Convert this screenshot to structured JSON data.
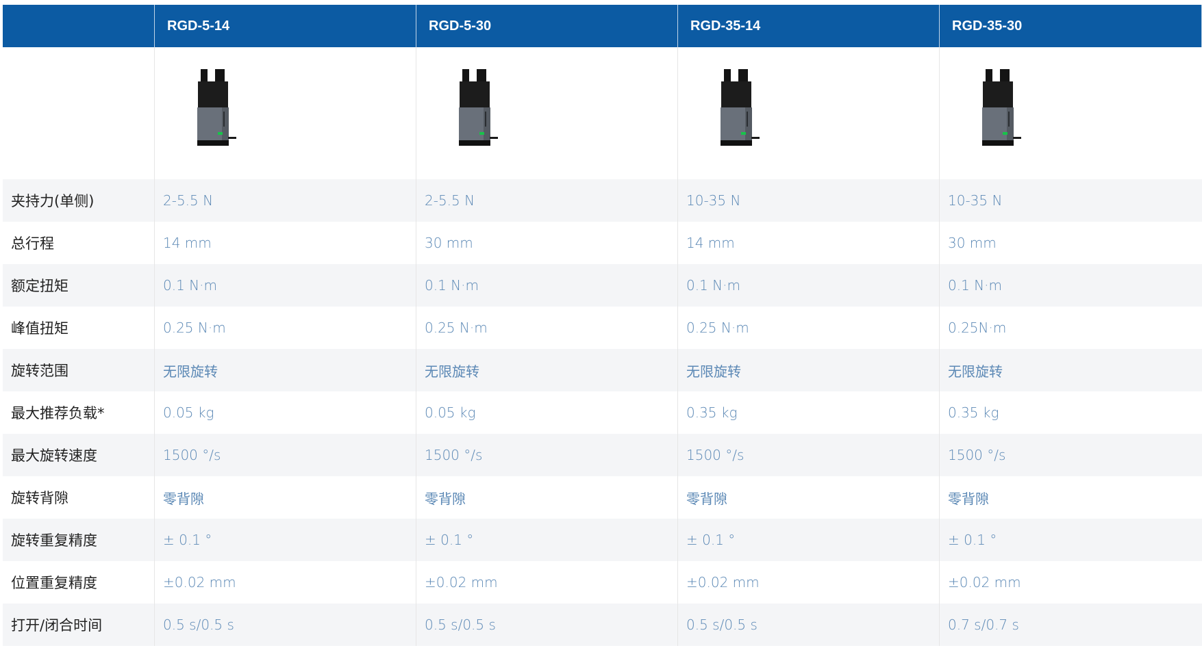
{
  "columns": [
    "",
    "RGD-5-14",
    "RGD-5-30",
    "RGD-35-14",
    "RGD-35-30"
  ],
  "product_image": "gripper-product-image",
  "rows": [
    {
      "label": "夹持力(单侧)",
      "values": [
        "2-5.5 N",
        "2-5.5 N",
        "10-35 N",
        "10-35 N"
      ]
    },
    {
      "label": "总行程",
      "values": [
        "14 mm",
        "30 mm",
        "14 mm",
        "30 mm"
      ]
    },
    {
      "label": "额定扭矩",
      "values": [
        "0.1 N·m",
        "0.1 N·m",
        "0.1 N·m",
        "0.1 N·m"
      ]
    },
    {
      "label": "峰值扭矩",
      "values": [
        "0.25 N·m",
        "0.25 N·m",
        "0.25 N·m",
        "0.25N·m"
      ]
    },
    {
      "label": "旋转范围",
      "values": [
        "无限旋转",
        "无限旋转",
        "无限旋转",
        "无限旋转"
      ]
    },
    {
      "label": "最大推荐负载*",
      "values": [
        "0.05 kg",
        "0.05 kg",
        "0.35 kg",
        "0.35 kg"
      ]
    },
    {
      "label": "最大旋转速度",
      "values": [
        "1500 °/s",
        "1500 °/s",
        "1500 °/s",
        "1500 °/s"
      ]
    },
    {
      "label": "旋转背隙",
      "values": [
        "零背隙",
        "零背隙",
        "零背隙",
        "零背隙"
      ]
    },
    {
      "label": "旋转重复精度",
      "values": [
        "± 0.1 °",
        "± 0.1 °",
        "± 0.1 °",
        "± 0.1 °"
      ]
    },
    {
      "label": "位置重复精度",
      "values": [
        "±0.02 mm",
        "±0.02 mm",
        "±0.02 mm",
        "±0.02 mm"
      ]
    },
    {
      "label": "打开/闭合时间",
      "values": [
        "0.5 s/0.5 s",
        "0.5 s/0.5 s",
        "0.5 s/0.5 s",
        "0.7 s/0.7 s"
      ]
    }
  ],
  "colors": {
    "header_bg": "#0c5ba3",
    "value_text": "#5b88b5",
    "stripe": "#f4f5f7"
  }
}
